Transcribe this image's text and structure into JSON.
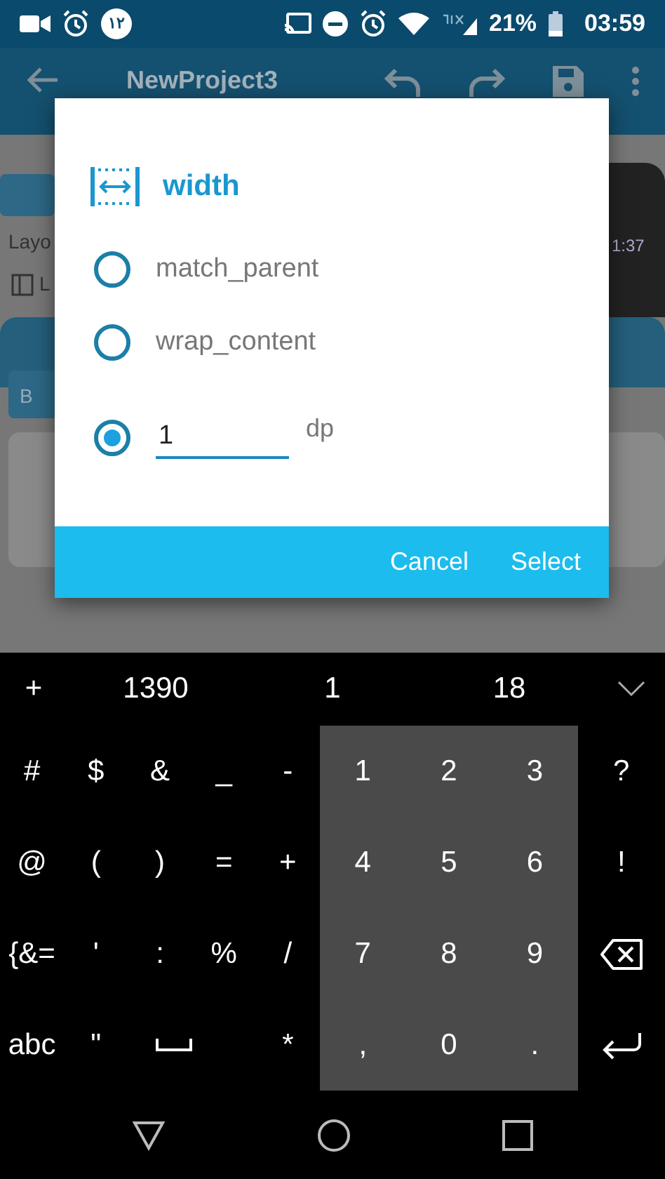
{
  "status_bar": {
    "badge": "۱۲",
    "battery": "21%",
    "time": "03:59"
  },
  "toolbar": {
    "title": "NewProject3"
  },
  "background": {
    "section_label": "Layo",
    "checkbox_label": "L",
    "tab_label": "B",
    "preview_clock": "1:37"
  },
  "dialog": {
    "title": "width",
    "options": [
      {
        "kind": "radio",
        "label": "match_parent",
        "selected": false
      },
      {
        "kind": "radio",
        "label": "wrap_content",
        "selected": false
      },
      {
        "kind": "input",
        "value": "1",
        "unit": "dp",
        "selected": true
      }
    ],
    "buttons": [
      "Cancel",
      "Select"
    ]
  },
  "keyboard": {
    "suggestions": [
      "+",
      "1390",
      "1",
      "18"
    ],
    "rows": [
      [
        {
          "kind": "symbol",
          "label": "#"
        },
        {
          "kind": "symbol",
          "label": "$"
        },
        {
          "kind": "symbol",
          "label": "&"
        },
        {
          "kind": "symbol",
          "label": "_"
        },
        {
          "kind": "symbol",
          "label": "-"
        },
        {
          "kind": "numpad",
          "label": "1"
        },
        {
          "kind": "numpad",
          "label": "2"
        },
        {
          "kind": "numpad",
          "label": "3"
        },
        {
          "kind": "symbol",
          "label": "?"
        }
      ],
      [
        {
          "kind": "symbol",
          "label": "@"
        },
        {
          "kind": "symbol",
          "label": "("
        },
        {
          "kind": "symbol",
          "label": ")"
        },
        {
          "kind": "symbol",
          "label": "="
        },
        {
          "kind": "symbol",
          "label": "+"
        },
        {
          "kind": "numpad",
          "label": "4"
        },
        {
          "kind": "numpad",
          "label": "5"
        },
        {
          "kind": "numpad",
          "label": "6"
        },
        {
          "kind": "symbol",
          "label": "!"
        }
      ],
      [
        {
          "kind": "symbol",
          "label": "{&="
        },
        {
          "kind": "symbol",
          "label": "'"
        },
        {
          "kind": "symbol",
          "label": ":"
        },
        {
          "kind": "symbol",
          "label": "%"
        },
        {
          "kind": "symbol",
          "label": "/"
        },
        {
          "kind": "numpad",
          "label": "7"
        },
        {
          "kind": "numpad",
          "label": "8"
        },
        {
          "kind": "numpad",
          "label": "9"
        },
        {
          "kind": "backspace"
        }
      ],
      [
        {
          "kind": "symbol",
          "label": "abc"
        },
        {
          "kind": "symbol",
          "label": "\""
        },
        {
          "kind": "space"
        },
        {
          "kind": "blank"
        },
        {
          "kind": "symbol",
          "label": "*"
        },
        {
          "kind": "numpad",
          "label": ","
        },
        {
          "kind": "numpad",
          "label": "0"
        },
        {
          "kind": "numpad",
          "label": "."
        },
        {
          "kind": "enter"
        }
      ]
    ]
  }
}
